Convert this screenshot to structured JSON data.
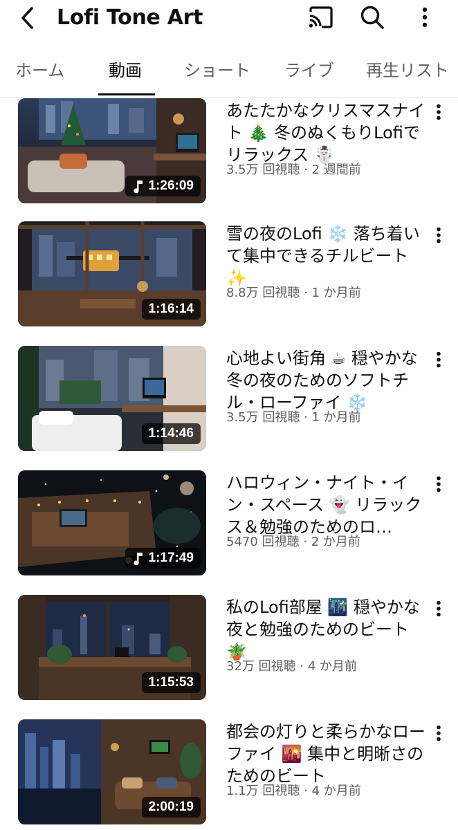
{
  "header": {
    "title": "Lofi Tone Art",
    "icons": {
      "back": "back-arrow-icon",
      "cast": "cast-icon",
      "search": "search-icon",
      "more": "more-vertical-icon"
    }
  },
  "tabs": [
    {
      "label": "ホーム",
      "active": false
    },
    {
      "label": "動画",
      "active": true
    },
    {
      "label": "ショート",
      "active": false
    },
    {
      "label": "ライブ",
      "active": false
    },
    {
      "label": "再生リスト",
      "active": false
    }
  ],
  "videos": [
    {
      "title": "あたたかなクリスマスナイト 🎄 冬のぬくもりLofiでリラックス ☃️",
      "views": "3.5万 回視聴",
      "age": "2 週間前",
      "duration": "1:26:09",
      "has_music_icon": true
    },
    {
      "title": "雪の夜のLofi ❄️ 落ち着いて集中できるチルビート✨",
      "views": "8.8万 回視聴",
      "age": "1 か月前",
      "duration": "1:16:14",
      "has_music_icon": false
    },
    {
      "title": "心地よい街角 ☕ 穏やかな冬の夜のためのソフトチル・ローファイ ❄️",
      "views": "3.5万 回視聴",
      "age": "1 か月前",
      "duration": "1:14:46",
      "has_music_icon": false
    },
    {
      "title": "ハロウィン・ナイト・イン・スペース 👻 リラックス＆勉強のためのロ…",
      "views": "5470 回視聴",
      "age": "2 か月前",
      "duration": "1:17:49",
      "has_music_icon": true
    },
    {
      "title": "私のLofi部屋 🌃 穏やかな夜と勉強のためのビート🪴",
      "views": "32万 回視聴",
      "age": "4 か月前",
      "duration": "1:15:53",
      "has_music_icon": false
    },
    {
      "title": "都会の灯りと柔らかなローファイ 🌇 集中と明晰さのためのビート",
      "views": "1.1万 回視聴",
      "age": "4 か月前",
      "duration": "2:00:19",
      "has_music_icon": false
    }
  ],
  "meta_separator": " · ",
  "colors": {
    "text_primary": "#0f0f0f",
    "text_secondary": "#606060",
    "tab_indicator": "#0f0f0f",
    "duration_badge": "#000000"
  }
}
